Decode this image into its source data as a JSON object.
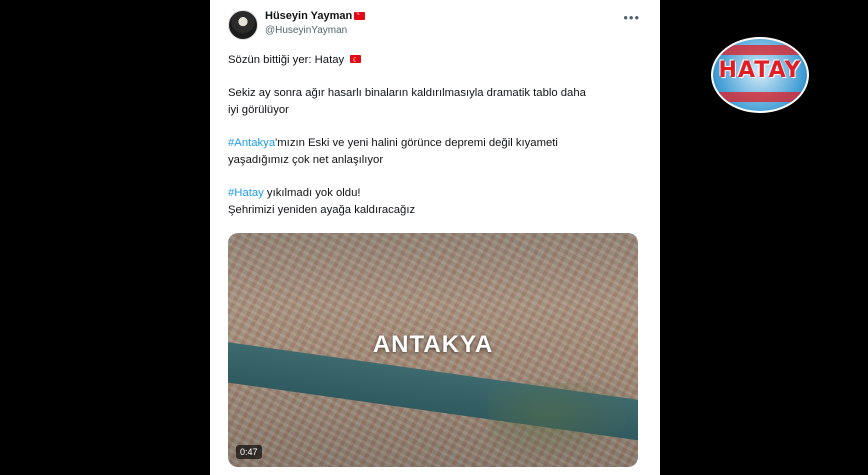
{
  "tweet": {
    "author_name": "Hüseyin Yayman",
    "author_handle": "@HuseyinYayman",
    "lines": {
      "l1": "Sözün bittiği yer: Hatay",
      "l2": "Sekiz ay sonra ağır hasarlı binaların kaldırılmasıyla dramatik tablo daha",
      "l3": "iyi görülüyor",
      "l4_hashtag": "#Antakya",
      "l4_rest": "'mızın Eski ve yeni halini görünce depremi değil kıyameti",
      "l5": "yaşadığımız çok net anlaşılıyor",
      "l6_hashtag": "#Hatay",
      "l6_rest": " yıkılmadı yok oldu!",
      "l7": "Şehrimizi yeniden ayağa kaldıracağız"
    },
    "media": {
      "overlay_text": "ANTAKYA",
      "duration": "0:47"
    }
  },
  "logo": {
    "text": "HATAY"
  },
  "icons": {
    "flag": "turkey-flag-icon",
    "more": "more-options-icon"
  },
  "colors": {
    "hashtag": "#1d9bf0",
    "background": "#000000",
    "logo_red": "#e21d24"
  }
}
